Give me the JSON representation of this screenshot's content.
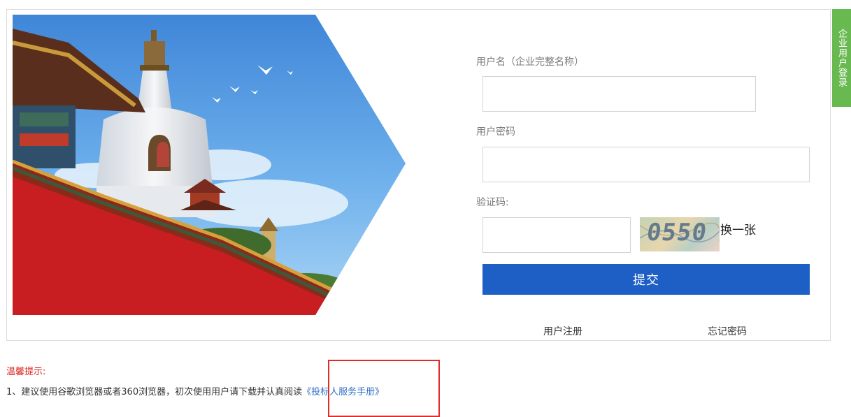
{
  "login": {
    "username_label": "用户名（企业完整名称）",
    "username_value": "",
    "password_label": "用户密码",
    "password_value": "",
    "captcha_label": "验证码:",
    "captcha_value": "",
    "captcha_text": "0550",
    "refresh_label": "换一张",
    "submit_label": "提交",
    "register_label": "用户注册",
    "forgot_label": "忘记密码"
  },
  "side_tab": {
    "label": "企业用户登录"
  },
  "tips": {
    "title": "温馨提示:",
    "line1_text": "1、建议使用谷歌浏览器或者360浏览器，初次使用用户请下载并认真阅读",
    "manual_link": "《投标人服务手册》"
  },
  "colors": {
    "primary_button": "#1e5fc6",
    "side_tab": "#69b951",
    "warning_text": "#d9231e",
    "link": "#2e6fc5",
    "highlight_box": "#e02b2b"
  }
}
